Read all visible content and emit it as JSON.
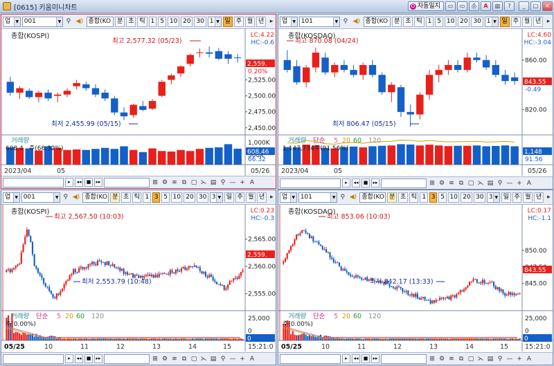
{
  "window": {
    "title": "[0615] 키움미니차트",
    "auto_log_label": "자동일지",
    "auto_log_glyph": "O",
    "icons": [
      "window-icon",
      "window-icon",
      "print-icon",
      "font-icon",
      "lock-icon",
      "help-icon"
    ],
    "icon_glyphs": [
      "▭",
      "▭",
      "⎙",
      "A",
      "▥",
      "?"
    ],
    "minimize_glyph": "_",
    "maximize_glyph": "□",
    "close_glyph": "×"
  },
  "toolbar_common": {
    "market_select": "업",
    "period_buttons": [
      "분",
      "초",
      "틱",
      "1",
      "3",
      "5",
      "10",
      "20",
      "30"
    ],
    "period_buttons_top": [
      "분",
      "초",
      "틱",
      "1",
      "5",
      "10",
      "20",
      "30"
    ],
    "day_week_month_year": [
      "일",
      "주",
      "월",
      "년"
    ],
    "sound_icon_glyph": "◀)"
  },
  "nav_common": {
    "buttons": [
      "▸",
      "◂◂",
      "■",
      "▸▸"
    ],
    "tools": [
      "⊞",
      "⚙",
      "≋",
      "⧉",
      "▢",
      "⋋",
      "▤",
      "⚲",
      "—",
      "+",
      "A"
    ]
  },
  "panels": [
    {
      "code": "001",
      "type_label": "종합(KO",
      "interval_value": "1",
      "period_active": "일",
      "period_active_index": null,
      "price_title": "종합(KOSPI)",
      "lc_label": "LC:4.22",
      "hc_label": "HC:-0.6",
      "yticks": [
        "2,525.00",
        "2,500.00",
        "2,475.00",
        "2,450.00"
      ],
      "current_price": "2,559.",
      "current_change": "0.20%",
      "high_annotation": "최고 2,577.32 (05/23)",
      "low_annotation": "최저 2,455.99 (05/15)",
      "vol_title": "거래량",
      "vol_info": "608,4",
      "vol_info2": "주(66.32%)",
      "vol_yticks": [
        "1,000K",
        "500K"
      ],
      "vol_current": "608,46",
      "vol_current2": "66.32",
      "xlabels": [
        "2023/04",
        "05",
        "05/26"
      ]
    },
    {
      "code": "101",
      "type_label": "종합(KO",
      "interval_value": "1",
      "period_active": "일",
      "price_title": "종합(KOSDAQ)",
      "lc_label": "LC:4.60",
      "hc_label": "HC:-3.04",
      "yticks": [
        "860.00",
        "820.00"
      ],
      "current_price": "843.55",
      "current_change": "-0.49",
      "high_annotation": "최고 870.08 (04/24)",
      "low_annotation": "최저 806.47 (05/15)",
      "vol_title": "거래량",
      "vol_ma_label": "단순",
      "vol_ma_values": [
        "5",
        "20",
        "60",
        "120"
      ],
      "vol_info": "1,147,734주(91.56%)",
      "vol_current": "1,148",
      "vol_current2": "91.56",
      "xlabels": [
        "2023/04",
        "05",
        "05/26"
      ]
    },
    {
      "code": "001",
      "type_label": "종합(KO",
      "interval_value": "3",
      "period_active": "분",
      "price_title": "종합(KOSPI)",
      "lc_label": "LC:0.23",
      "hc_label": "HC:-0.3",
      "yticks": [
        "2,565.00",
        "2,560.00",
        "2,555.00"
      ],
      "current_price": "2,559.",
      "high_annotation": "최고 2,567.50 (10:03)",
      "low_annotation": "최저 2,553.79 (10:48)",
      "vol_title": "거래량",
      "vol_ma_label": "단순",
      "vol_ma_values": [
        "5",
        "20",
        "60",
        "120"
      ],
      "vol_info": "주(0.00%)",
      "vol_yticks": [
        "25,000",
        "0"
      ],
      "vol_current": "0",
      "xlabels": [
        "05/25",
        "10",
        "11",
        "12",
        "13",
        "14",
        "15",
        "15:21:0"
      ]
    },
    {
      "code": "101",
      "type_label": "종합(KO",
      "interval_value": "3",
      "period_active": "분",
      "price_title": "종합(KOSDAQ)",
      "lc_label": "LC:0.17",
      "hc_label": "HC:-1.1",
      "yticks": [
        "850.00",
        "847.50",
        "845.00"
      ],
      "current_price": "843.55",
      "high_annotation": "최고 853.06 (10:03)",
      "low_annotation": "최저 842.17 (13:33)",
      "vol_title": "거래량",
      "vol_ma_label": "단순",
      "vol_ma_values": [
        "5",
        "20",
        "60",
        "120"
      ],
      "vol_info": "주(0.00%)",
      "vol_yticks": [
        "25,000",
        "0"
      ],
      "vol_current": "0",
      "xlabels": [
        "05/25",
        "10",
        "11",
        "12",
        "13",
        "14",
        "15",
        "15:21:0"
      ]
    }
  ],
  "colors": {
    "up": "#e8201c",
    "down": "#1460c8",
    "panel_border_active": "#d23a52",
    "ma5": "#e05a9a",
    "ma20": "#d0a000",
    "ma60": "#2a9a2a",
    "ma120": "#888888"
  },
  "chart_data": [
    {
      "type": "candlestick",
      "title": "종합(KOSPI)",
      "ylim": [
        2440,
        2585
      ],
      "ohlc": [
        [
          2522,
          2530,
          2500,
          2505
        ],
        [
          2505,
          2515,
          2495,
          2512
        ],
        [
          2508,
          2512,
          2495,
          2498
        ],
        [
          2498,
          2508,
          2490,
          2505
        ],
        [
          2505,
          2510,
          2492,
          2496
        ],
        [
          2500,
          2505,
          2490,
          2502
        ],
        [
          2502,
          2512,
          2498,
          2508
        ],
        [
          2515,
          2525,
          2510,
          2520
        ],
        [
          2518,
          2522,
          2508,
          2512
        ],
        [
          2512,
          2518,
          2498,
          2502
        ],
        [
          2505,
          2510,
          2492,
          2496
        ],
        [
          2496,
          2500,
          2470,
          2474
        ],
        [
          2474,
          2482,
          2462,
          2468
        ],
        [
          2470,
          2488,
          2466,
          2486
        ],
        [
          2484,
          2492,
          2476,
          2478
        ],
        [
          2480,
          2495,
          2478,
          2492
        ],
        [
          2500,
          2525,
          2498,
          2522
        ],
        [
          2525,
          2535,
          2518,
          2532
        ],
        [
          2535,
          2548,
          2530,
          2546
        ],
        [
          2550,
          2566,
          2546,
          2564
        ],
        [
          2568,
          2574,
          2560,
          2568
        ],
        [
          2568,
          2577,
          2560,
          2566
        ],
        [
          2570,
          2575,
          2556,
          2558
        ],
        [
          2565,
          2570,
          2550,
          2558
        ],
        [
          2560,
          2566,
          2552,
          2559
        ]
      ],
      "volume_k": [
        660,
        640,
        620,
        540,
        700,
        640,
        560,
        580,
        560,
        600,
        640,
        600,
        700,
        560,
        480,
        620,
        520,
        500,
        560,
        520,
        600,
        640,
        660,
        780,
        608
      ]
    },
    {
      "type": "candlestick",
      "title": "종합(KOSDAQ)",
      "ylim": [
        800,
        875
      ],
      "ohlc": [
        [
          860,
          868,
          850,
          852
        ],
        [
          855,
          860,
          840,
          842
        ],
        [
          842,
          856,
          838,
          854
        ],
        [
          854,
          870,
          850,
          866
        ],
        [
          862,
          866,
          848,
          850
        ],
        [
          850,
          858,
          846,
          856
        ],
        [
          856,
          860,
          850,
          852
        ],
        [
          852,
          856,
          846,
          848
        ],
        [
          848,
          858,
          844,
          856
        ],
        [
          856,
          860,
          846,
          848
        ],
        [
          848,
          850,
          832,
          834
        ],
        [
          834,
          842,
          826,
          840
        ],
        [
          838,
          840,
          814,
          818
        ],
        [
          818,
          824,
          806,
          816
        ],
        [
          816,
          834,
          812,
          832
        ],
        [
          832,
          852,
          828,
          848
        ],
        [
          848,
          856,
          842,
          852
        ],
        [
          852,
          860,
          848,
          856
        ],
        [
          856,
          860,
          850,
          852
        ],
        [
          852,
          866,
          850,
          862
        ],
        [
          862,
          866,
          858,
          860
        ],
        [
          860,
          864,
          852,
          854
        ],
        [
          856,
          860,
          846,
          848
        ],
        [
          848,
          852,
          840,
          843
        ],
        [
          846,
          850,
          840,
          843
        ]
      ],
      "volume_k": [
        1100,
        1080,
        1250,
        1200,
        1050,
        1020,
        1100,
        1130,
        1080,
        1150,
        1180,
        1200,
        1280,
        1260,
        1200,
        1250,
        1200,
        1160,
        1180,
        1180,
        1200,
        1150,
        1170,
        1200,
        1148
      ]
    },
    {
      "type": "candlestick",
      "title": "종합(KOSPI) 3분",
      "ylim": [
        2552,
        2569
      ],
      "x_ticks": [
        "05/25",
        "10",
        "11",
        "12",
        "13",
        "14",
        "15"
      ]
    },
    {
      "type": "candlestick",
      "title": "종합(KOSDAQ) 3분",
      "ylim": [
        841,
        855
      ],
      "x_ticks": [
        "05/25",
        "10",
        "11",
        "12",
        "13",
        "14",
        "15"
      ]
    }
  ]
}
